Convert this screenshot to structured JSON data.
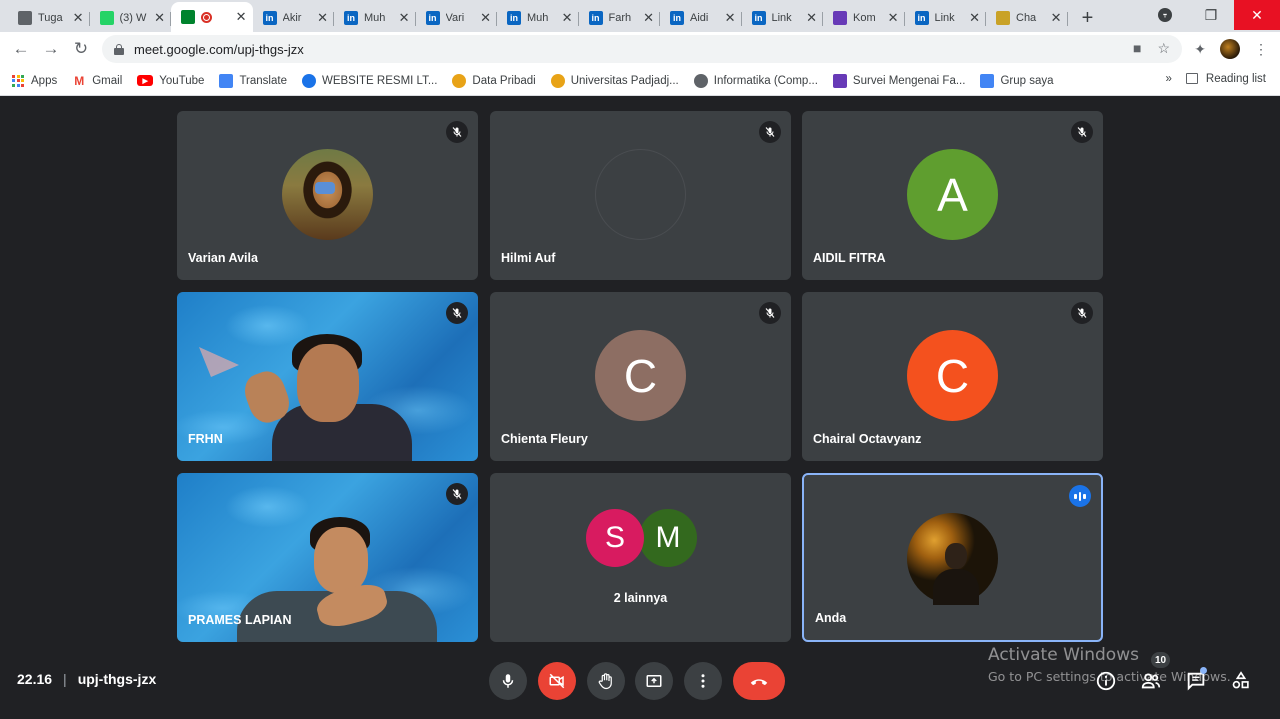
{
  "browser": {
    "tabs": [
      {
        "title": "Tuga",
        "favicon": "classroom-icon",
        "color": "#5f6368",
        "active": false
      },
      {
        "title": "(3) W",
        "favicon": "whatsapp-icon",
        "color": "#25d366",
        "active": false
      },
      {
        "title": "",
        "favicon": "meet-icon",
        "color": "#00832d",
        "active": true,
        "recording": true
      },
      {
        "title": "Akir",
        "favicon": "linkedin-icon",
        "color": "#0a66c2",
        "active": false
      },
      {
        "title": "Muh",
        "favicon": "linkedin-icon",
        "color": "#0a66c2",
        "active": false
      },
      {
        "title": "Vari",
        "favicon": "linkedin-icon",
        "color": "#0a66c2",
        "active": false
      },
      {
        "title": "Muh",
        "favicon": "linkedin-icon",
        "color": "#0a66c2",
        "active": false
      },
      {
        "title": "Farh",
        "favicon": "linkedin-icon",
        "color": "#0a66c2",
        "active": false
      },
      {
        "title": "Aidi",
        "favicon": "linkedin-icon",
        "color": "#0a66c2",
        "active": false
      },
      {
        "title": "Link",
        "favicon": "linkedin-icon",
        "color": "#0a66c2",
        "active": false
      },
      {
        "title": "Kom",
        "favicon": "forms-icon",
        "color": "#673ab7",
        "active": false
      },
      {
        "title": "Link",
        "favicon": "linkedin-icon",
        "color": "#0a66c2",
        "active": false
      },
      {
        "title": "Cha",
        "favicon": "chat-logo-icon",
        "color": "#c9a227",
        "active": false
      }
    ],
    "url": "meet.google.com/upj-thgs-jzx",
    "bookmarks": [
      {
        "label": "Apps",
        "icon": "apps-grid-icon",
        "color": "#ea4335"
      },
      {
        "label": "Gmail",
        "icon": "gmail-icon",
        "color": "#ea4335"
      },
      {
        "label": "YouTube",
        "icon": "youtube-icon",
        "color": "#ff0000"
      },
      {
        "label": "Translate",
        "icon": "translate-icon",
        "color": "#4285f4"
      },
      {
        "label": "WEBSITE RESMI LT...",
        "icon": "globe-icon",
        "color": "#1a73e8"
      },
      {
        "label": "Data Pribadi",
        "icon": "unpad-icon",
        "color": "#e8a317"
      },
      {
        "label": "Universitas Padjadj...",
        "icon": "unpad-icon",
        "color": "#e8a317"
      },
      {
        "label": "Informatika (Comp...",
        "icon": "globe-icon",
        "color": "#5f6368"
      },
      {
        "label": "Survei Mengenai Fa...",
        "icon": "forms-icon",
        "color": "#673ab7"
      },
      {
        "label": "Grup saya",
        "icon": "group-icon",
        "color": "#4285f4"
      }
    ],
    "more_bookmarks": "»",
    "reading_list": "Reading list"
  },
  "participants": [
    {
      "name": "Varian Avila",
      "type": "photo",
      "muted": true
    },
    {
      "name": "Hilmi Auf",
      "type": "empty",
      "muted": true
    },
    {
      "name": "AIDIL FITRA",
      "type": "initial",
      "initial": "A",
      "color": "#5f9e2f",
      "muted": true
    },
    {
      "name": "FRHN",
      "type": "video",
      "muted": true
    },
    {
      "name": "Chienta Fleury",
      "type": "initial",
      "initial": "C",
      "color": "#8d6e63",
      "muted": true
    },
    {
      "name": "Chairal Octavyanz",
      "type": "initial",
      "initial": "C",
      "color": "#f4511e",
      "muted": true
    },
    {
      "name": "PRAMES LAPIAN",
      "type": "video",
      "muted": true
    },
    {
      "name": "2 lainnya",
      "type": "others",
      "avatars": [
        {
          "initial": "S",
          "color": "#d81b60"
        },
        {
          "initial": "M",
          "color": "#33691e"
        }
      ]
    },
    {
      "name": "Anda",
      "type": "photo",
      "speaking": true
    }
  ],
  "meeting": {
    "time": "22.16",
    "separator": "|",
    "code": "upj-thgs-jzx",
    "participant_count": "10"
  },
  "watermark": {
    "line1": "Activate Windows",
    "line2": "Go to PC settings to activate Windows."
  }
}
